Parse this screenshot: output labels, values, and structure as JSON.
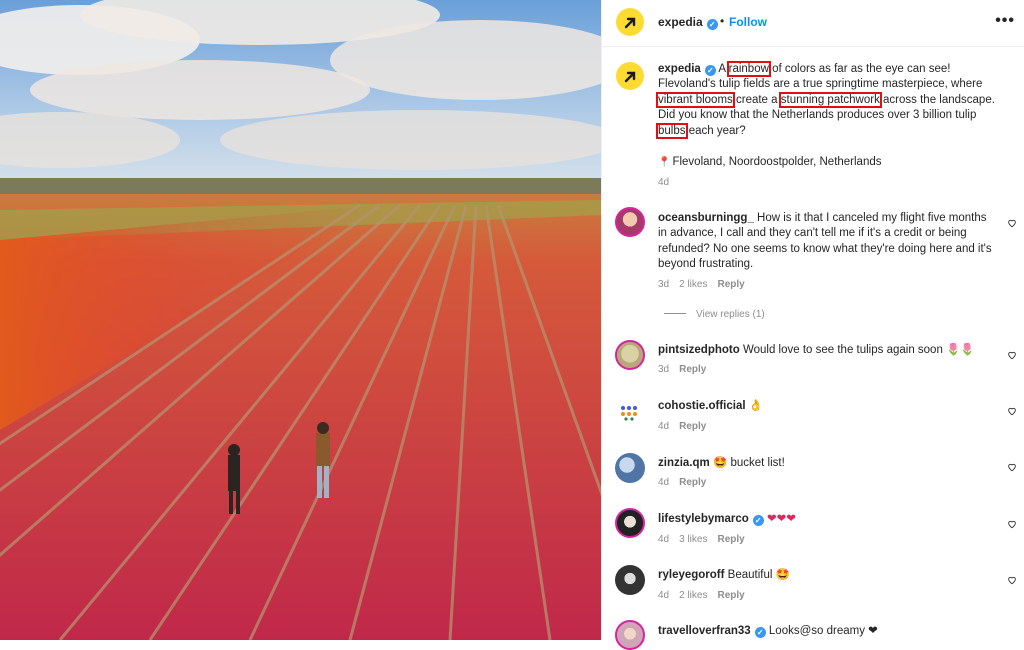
{
  "post": {
    "username": "expedia",
    "follow_label": "Follow",
    "more_label": "•••",
    "caption": {
      "t1": " A ",
      "h1": "rainbow",
      "t2": " of colors as far as the eye can see! Flevoland's tulip fields are a true springtime masterpiece, where ",
      "h2": "vibrant blooms",
      "t3": " create a ",
      "h3": "stunning patchwork",
      "t4": " across the landscape. Did you know that the Netherlands produces over 3 billion tulip ",
      "h4": "bulbs",
      "t5": " each year?"
    },
    "location": "Flevoland, Noordoostpolder, Netherlands",
    "time": "4d"
  },
  "comments": [
    {
      "user": "oceansburningg_",
      "text": " How is it that I canceled my flight five months in advance, I call and they can't tell me if it's a credit or being refunded? No one seems to know what they're doing here and it's beyond frustrating.",
      "time": "3d",
      "likes": "2 likes",
      "reply": "Reply"
    },
    {
      "user": "pintsizedphoto",
      "text": " Would love to see the tulips again soon 🌷🌷",
      "time": "3d",
      "likes": "",
      "reply": "Reply"
    },
    {
      "user": "cohostie.official",
      "text": " 👌",
      "time": "4d",
      "likes": "",
      "reply": "Reply"
    },
    {
      "user": "zinzia.qm",
      "text": " 🤩 bucket list!",
      "time": "4d",
      "likes": "",
      "reply": "Reply"
    },
    {
      "user": "lifestylebymarco",
      "text": " ❤❤❤",
      "time": "4d",
      "likes": "3 likes",
      "reply": "Reply"
    },
    {
      "user": "ryleyegoroff",
      "text": " Beautiful 🤩",
      "time": "4d",
      "likes": "2 likes",
      "reply": "Reply"
    },
    {
      "user": "travelloverfran33",
      "text": " Looks@so dreamy ❤",
      "time": "",
      "likes": "",
      "reply": ""
    }
  ],
  "view_replies_label": "View replies (1)",
  "colors": {
    "follow": "#0095f6",
    "verified": "#3897f0",
    "logo": "#fddb32",
    "highlight": "#dd1111"
  }
}
